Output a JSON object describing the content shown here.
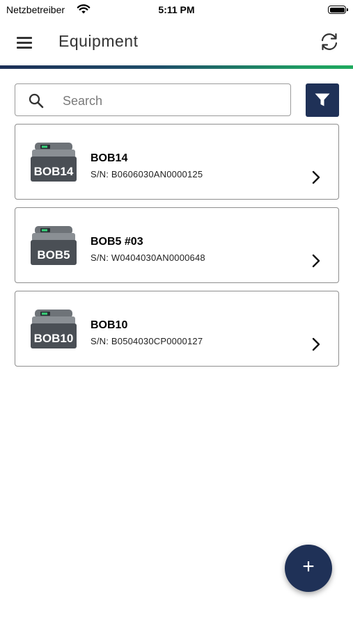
{
  "status_bar": {
    "carrier": "Netzbetreiber",
    "time": "5:11 PM"
  },
  "header": {
    "title": "Equipment"
  },
  "search": {
    "placeholder": "Search",
    "value": ""
  },
  "equipment": [
    {
      "device_label": "BOB14",
      "name": "BOB14",
      "serial": "S/N: B0606030AN0000125"
    },
    {
      "device_label": "BOB5",
      "name": "BOB5 #03",
      "serial": "S/N: W0404030AN0000648"
    },
    {
      "device_label": "BOB10",
      "name": "BOB10",
      "serial": "S/N: B0504030CP0000127"
    }
  ],
  "fab": {
    "label": "+"
  },
  "colors": {
    "primary": "#1f3157",
    "accent_green": "#1faa5e",
    "border": "#8e8e8e"
  }
}
